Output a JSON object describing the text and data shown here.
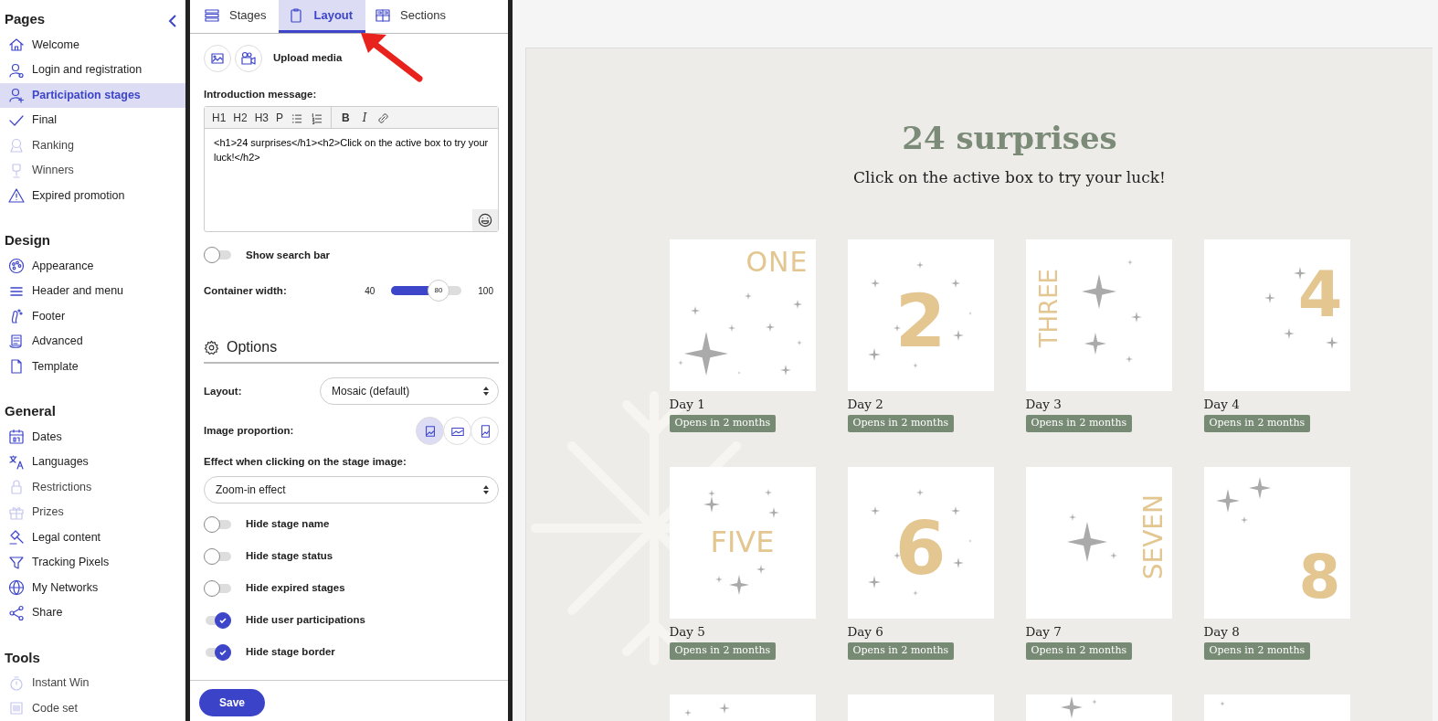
{
  "sidebar": {
    "sections": [
      {
        "title": "Pages",
        "items": [
          {
            "label": "Welcome",
            "selected": false,
            "disabled": false
          },
          {
            "label": "Login and registration",
            "selected": false,
            "disabled": false
          },
          {
            "label": "Participation stages",
            "selected": true,
            "disabled": false
          },
          {
            "label": "Final",
            "selected": false,
            "disabled": false
          },
          {
            "label": "Ranking",
            "selected": false,
            "disabled": true
          },
          {
            "label": "Winners",
            "selected": false,
            "disabled": true
          },
          {
            "label": "Expired promotion",
            "selected": false,
            "disabled": false
          }
        ]
      },
      {
        "title": "Design",
        "items": [
          {
            "label": "Appearance",
            "selected": false,
            "disabled": false
          },
          {
            "label": "Header and menu",
            "selected": false,
            "disabled": false
          },
          {
            "label": "Footer",
            "selected": false,
            "disabled": false
          },
          {
            "label": "Advanced",
            "selected": false,
            "disabled": false
          },
          {
            "label": "Template",
            "selected": false,
            "disabled": false
          }
        ]
      },
      {
        "title": "General",
        "items": [
          {
            "label": "Dates",
            "selected": false,
            "disabled": false
          },
          {
            "label": "Languages",
            "selected": false,
            "disabled": false
          },
          {
            "label": "Restrictions",
            "selected": false,
            "disabled": true
          },
          {
            "label": "Prizes",
            "selected": false,
            "disabled": true
          },
          {
            "label": "Legal content",
            "selected": false,
            "disabled": false
          },
          {
            "label": "Tracking Pixels",
            "selected": false,
            "disabled": false
          },
          {
            "label": "My Networks",
            "selected": false,
            "disabled": false
          },
          {
            "label": "Share",
            "selected": false,
            "disabled": false
          }
        ]
      },
      {
        "title": "Tools",
        "items": [
          {
            "label": "Instant Win",
            "selected": false,
            "disabled": true
          },
          {
            "label": "Code set",
            "selected": false,
            "disabled": true
          }
        ]
      }
    ]
  },
  "tabs": [
    {
      "label": "Stages",
      "selected": false
    },
    {
      "label": "Layout",
      "selected": true
    },
    {
      "label": "Sections",
      "selected": false
    }
  ],
  "upload_media": {
    "label": "Upload media"
  },
  "intro": {
    "label": "Introduction message:",
    "headings": [
      "H1",
      "H2",
      "H3",
      "P"
    ],
    "formats": [
      "B",
      "I"
    ],
    "value": "<h1>24 surprises</h1><h2>Click on the active box to try your luck!</h2>"
  },
  "show_search_bar": {
    "label": "Show search bar",
    "on": false
  },
  "container_width": {
    "label": "Container width:",
    "min": "40",
    "max": "100",
    "reading": "80",
    "level": 0.67
  },
  "options": {
    "title": "Options",
    "layout": {
      "label": "Layout:",
      "value": "Mosaic (default)"
    },
    "image_proportion": {
      "label": "Image proportion:",
      "choices": [
        {
          "kind": "square",
          "selected": true
        },
        {
          "kind": "landscape",
          "selected": false
        },
        {
          "kind": "portrait",
          "selected": false
        }
      ]
    },
    "effect": {
      "label": "Effect when clicking on the stage image:",
      "value": "Zoom-in effect"
    },
    "toggles": [
      {
        "label": "Hide stage name",
        "on": false
      },
      {
        "label": "Hide stage status",
        "on": false
      },
      {
        "label": "Hide expired stages",
        "on": false
      },
      {
        "label": "Hide user participations",
        "on": true
      },
      {
        "label": "Hide stage border",
        "on": true
      }
    ]
  },
  "save_button": "Save",
  "preview": {
    "title": "24 surprises",
    "subtitle": "Click on the active box to try your luck!",
    "stages": [
      {
        "name": "Day 1",
        "status": "Opens in 2 months",
        "art_text": "ONE",
        "kind": "top-right"
      },
      {
        "name": "Day 2",
        "status": "Opens in 2 months",
        "art_text": "2",
        "kind": "center"
      },
      {
        "name": "Day 3",
        "status": "Opens in 2 months",
        "art_text": "THREE",
        "kind": "vertical-left"
      },
      {
        "name": "Day 4",
        "status": "Opens in 2 months",
        "art_text": "4",
        "kind": "right"
      },
      {
        "name": "Day 5",
        "status": "Opens in 2 months",
        "art_text": "FIVE",
        "kind": "center-word"
      },
      {
        "name": "Day 6",
        "status": "Opens in 2 months",
        "art_text": "6",
        "kind": "center"
      },
      {
        "name": "Day 7",
        "status": "Opens in 2 months",
        "art_text": "SEVEN",
        "kind": "vertical-right"
      },
      {
        "name": "Day 8",
        "status": "Opens in 2 months",
        "art_text": "8",
        "kind": "bottom-right"
      }
    ]
  }
}
